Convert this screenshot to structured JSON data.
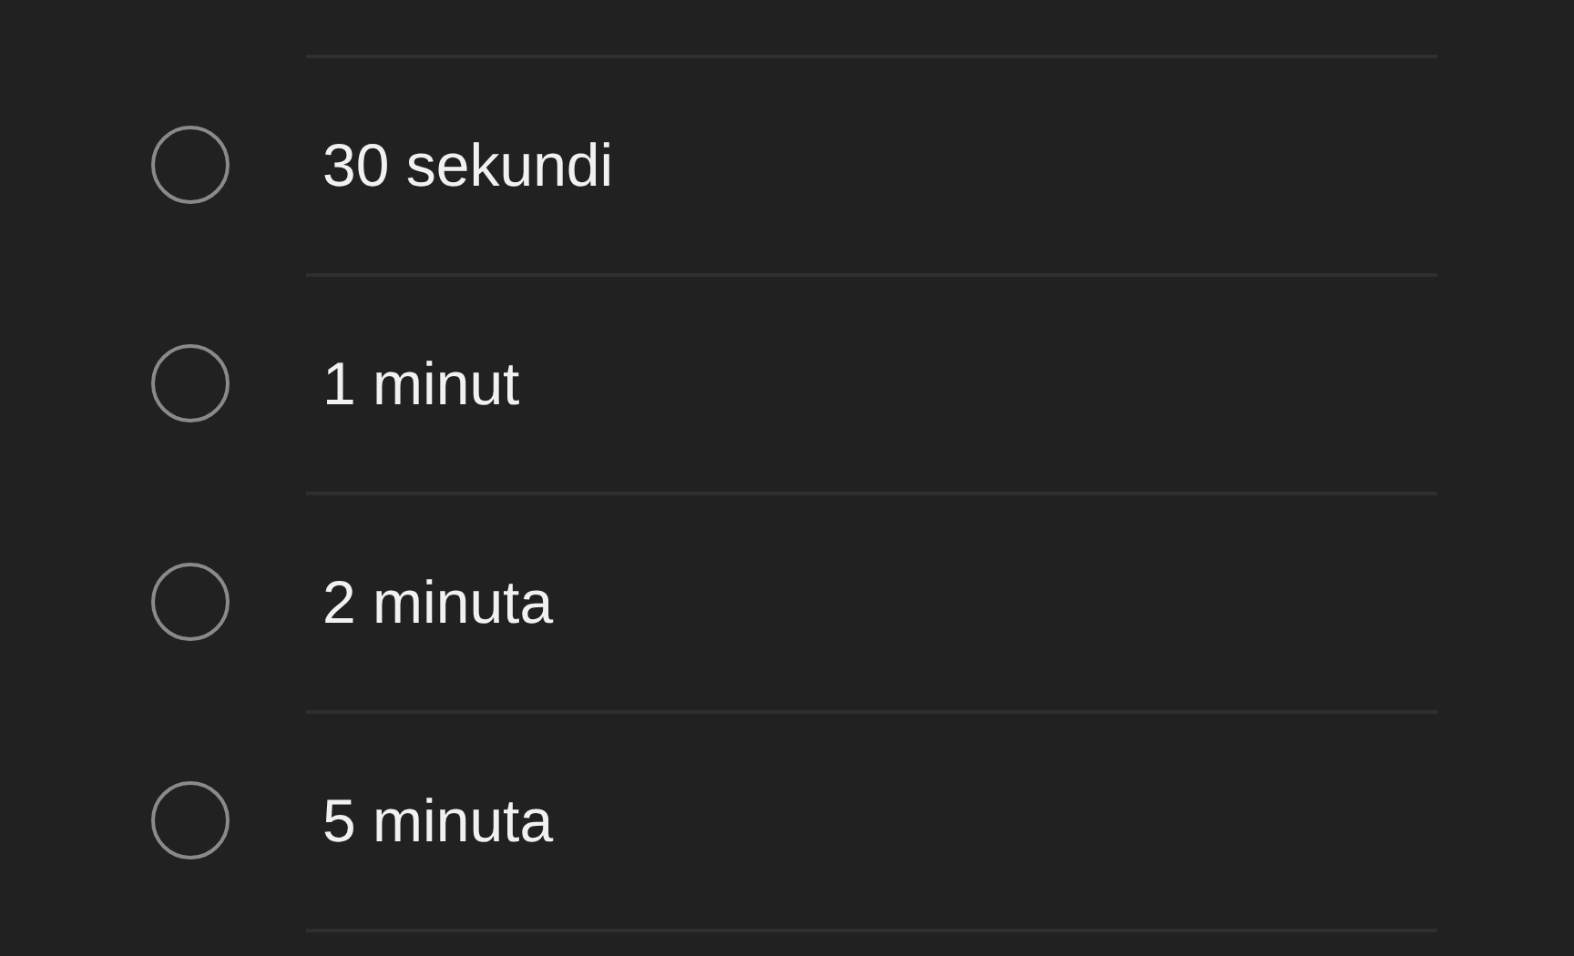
{
  "options": [
    {
      "label": "30 sekundi",
      "selected": false
    },
    {
      "label": "1 minut",
      "selected": false
    },
    {
      "label": "2 minuta",
      "selected": false
    },
    {
      "label": "5 minuta",
      "selected": false
    }
  ]
}
